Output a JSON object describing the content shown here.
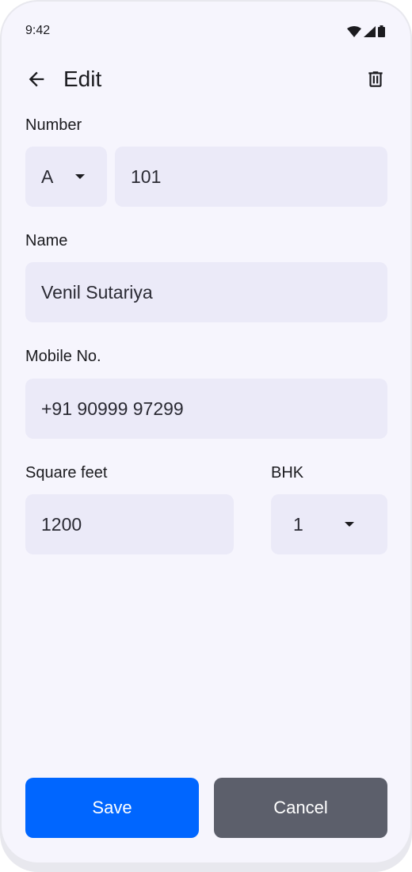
{
  "status_bar": {
    "time": "9:42",
    "icons": [
      "wifi-icon",
      "signal-icon",
      "battery-icon"
    ]
  },
  "app_bar": {
    "title": "Edit",
    "back_icon": "arrow-left-icon",
    "delete_icon": "trash-icon"
  },
  "form": {
    "number": {
      "label": "Number",
      "block": "A",
      "unit": "101"
    },
    "name": {
      "label": "Name",
      "value": "Venil Sutariya"
    },
    "mobile": {
      "label": "Mobile No.",
      "value": "+91 90999 97299"
    },
    "square_feet": {
      "label": "Square feet",
      "value": "1200"
    },
    "bhk": {
      "label": "BHK",
      "value": "1"
    }
  },
  "actions": {
    "save_label": "Save",
    "cancel_label": "Cancel"
  },
  "colors": {
    "background": "#f6f5fd",
    "field": "#ebeaf8",
    "primary": "#0066ff",
    "secondary": "#5c5f6b"
  }
}
